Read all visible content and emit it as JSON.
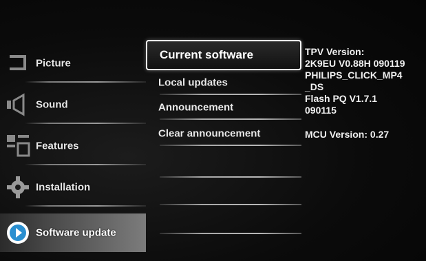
{
  "left_menu": {
    "items": [
      {
        "label": "Picture",
        "icon": "picture-icon"
      },
      {
        "label": "Sound",
        "icon": "speaker-icon"
      },
      {
        "label": "Features",
        "icon": "features-icon"
      },
      {
        "label": "Installation",
        "icon": "gear-icon"
      },
      {
        "label": "Software update",
        "icon": "software-update-icon",
        "selected": true
      }
    ]
  },
  "sub_menu": {
    "items": [
      {
        "label": "Current software",
        "highlighted": true
      },
      {
        "label": "Local updates"
      },
      {
        "label": "Announcement"
      },
      {
        "label": "Clear announcement"
      },
      {
        "label": ""
      },
      {
        "label": ""
      },
      {
        "label": ""
      }
    ]
  },
  "info_panel": {
    "lines": [
      "TPV Version:",
      "2K9EU V0.88H 090119",
      "PHILIPS_CLICK_MP4",
      "_DS",
      "Flash PQ V1.7.1",
      "090115"
    ],
    "mcu_line": "MCU Version: 0.27"
  },
  "colors": {
    "background": "#0b0b0b",
    "text": "#f2f2f2",
    "selected_bg": "#7c7c7c",
    "highlight_border": "#ffffff"
  }
}
